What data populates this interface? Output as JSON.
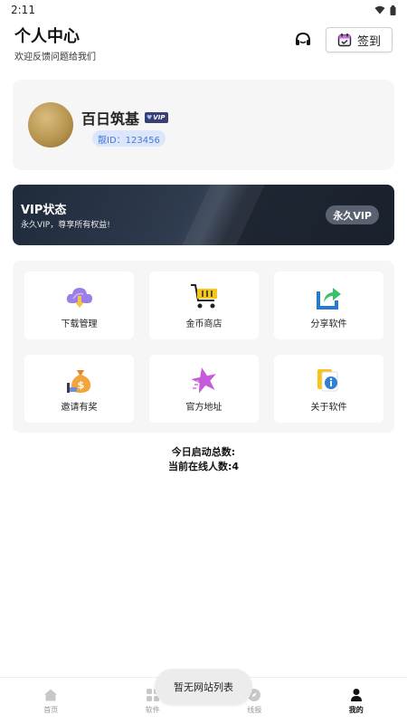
{
  "status_bar": {
    "time": "2:11",
    "wifi_icon": "wifi-icon",
    "battery_icon": "battery-icon"
  },
  "header": {
    "title": "个人中心",
    "subtitle": "欢迎反馈问题给我们",
    "support_icon": "headset-icon",
    "checkin_label": "签到",
    "checkin_icon": "calendar-icon"
  },
  "profile": {
    "username": "百日筑基",
    "vip_badge": "VIP",
    "id_text": "靓ID：123456"
  },
  "vip": {
    "title": "VIP状态",
    "description": "永久VIP，尊享所有权益!",
    "badge": "永久VIP"
  },
  "menu": {
    "items": [
      {
        "label": "下载管理",
        "icon": "cloud-download-icon"
      },
      {
        "label": "金币商店",
        "icon": "shopping-cart-icon"
      },
      {
        "label": "分享软件",
        "icon": "share-icon"
      },
      {
        "label": "邀请有奖",
        "icon": "money-bag-icon"
      },
      {
        "label": "官方地址",
        "icon": "star-icon"
      },
      {
        "label": "关于软件",
        "icon": "info-icon"
      }
    ]
  },
  "stats": {
    "launch_total": "今日启动总数:",
    "online_now": "当前在线人数:4"
  },
  "tabs": [
    {
      "label": "首页",
      "icon": "home-icon",
      "active": false
    },
    {
      "label": "软件",
      "icon": "grid-icon",
      "active": false
    },
    {
      "label": "线报",
      "icon": "compass-icon",
      "active": false
    },
    {
      "label": "我的",
      "icon": "user-icon",
      "active": true
    }
  ],
  "toast": {
    "text": "暂无网站列表"
  },
  "colors": {
    "accent": "#4a78d6",
    "vip_dark": "#1f2a3a",
    "card_bg": "#f6f6f6"
  }
}
